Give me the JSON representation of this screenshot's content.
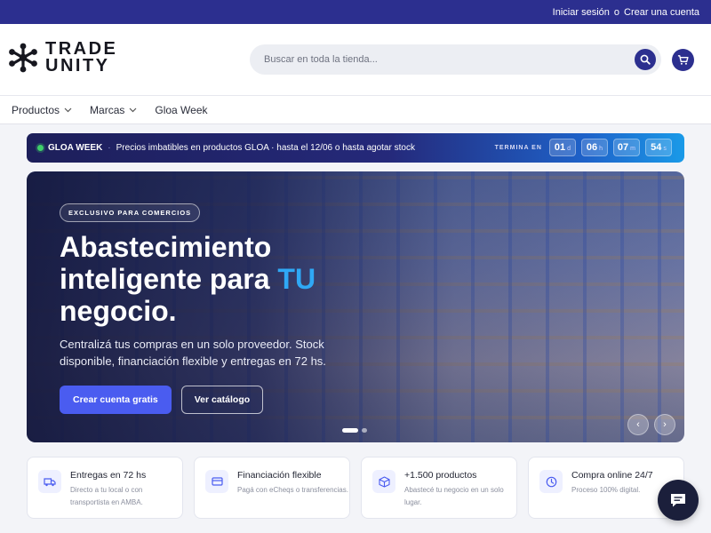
{
  "topbar": {
    "login": "Iniciar sesión",
    "or": "o",
    "register": "Crear una cuenta"
  },
  "brand": {
    "line1": "TRADE",
    "line2": "UNITY"
  },
  "search": {
    "placeholder": "Buscar en toda la tienda..."
  },
  "nav": {
    "items": [
      {
        "label": "Productos",
        "has_dropdown": true
      },
      {
        "label": "Marcas",
        "has_dropdown": true
      },
      {
        "label": "Gloa Week",
        "has_dropdown": false
      }
    ]
  },
  "promo": {
    "tag": "GLOA WEEK",
    "separator": "·",
    "text": "Precios imbatibles en productos GLOA · hasta el 12/06 o hasta agotar stock",
    "countdown_label": "TERMINA EN",
    "countdown": [
      {
        "value": "01",
        "unit": "d"
      },
      {
        "value": "06",
        "unit": "h"
      },
      {
        "value": "07",
        "unit": "m"
      },
      {
        "value": "54",
        "unit": "s"
      }
    ]
  },
  "hero": {
    "badge": "EXCLUSIVO PARA COMERCIOS",
    "title_line1": "Abastecimiento",
    "title_line2": "inteligente para",
    "title_accent": "TU",
    "title_line3": "negocio.",
    "subtitle": "Centralizá tus compras en un solo proveedor. Stock disponible, financiación flexible y entregas en 72 hs.",
    "primary_button": "Crear cuenta gratis",
    "secondary_button": "Ver catálogo",
    "slides": 2,
    "active_slide": 1
  },
  "features": [
    {
      "icon": "truck-icon",
      "title": "Entregas en 72 hs",
      "desc": "Directo a tu local o con transportista en AMBA."
    },
    {
      "icon": "credit-card-icon",
      "title": "Financiación flexible",
      "desc": "Pagá con eCheqs o transferencias."
    },
    {
      "icon": "box-icon",
      "title": "+1.500 productos",
      "desc": "Abastecé tu negocio en un solo lugar."
    },
    {
      "icon": "clock-icon",
      "title": "Compra online 24/7",
      "desc": "Proceso 100% digital."
    }
  ],
  "colors": {
    "brand": "#2c2f8f",
    "accent": "#4a5cf0",
    "highlight": "#2fa8f5",
    "promo_dot": "#3fd06a"
  }
}
